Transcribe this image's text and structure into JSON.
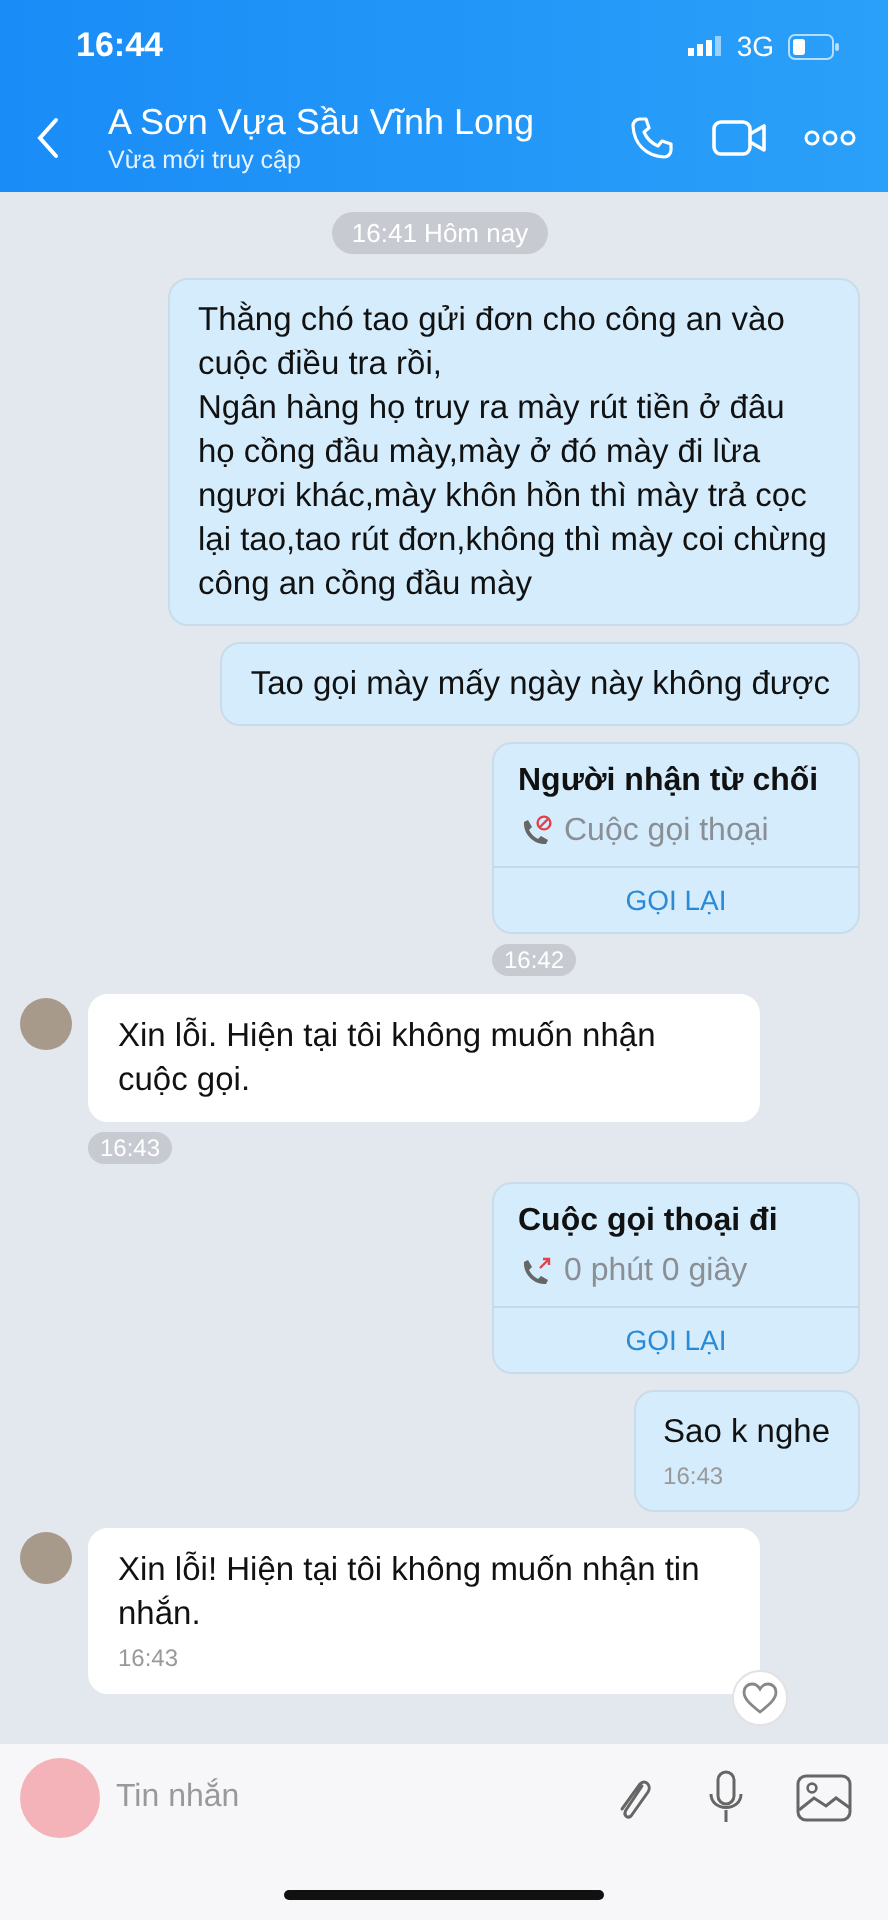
{
  "status_bar": {
    "time": "16:44",
    "network": "3G"
  },
  "header": {
    "title": "A Sơn Vựa Sầu Vĩnh Long",
    "subtitle": "Vừa mới truy cập"
  },
  "date_divider": "16:41 Hôm nay",
  "messages": [
    {
      "kind": "text",
      "outgoing": true,
      "text": "Thằng chó tao gửi đơn cho công an vào cuộc điều tra rồi,\nNgân hàng họ truy ra mày rút tiền ở đâu họ cồng đầu mày,mày ở đó mày đi lừa ngươi khác,mày khôn hồn thì mày trả cọc lại tao,tao rút đơn,không thì mày coi chừng công an cồng đầu mày"
    },
    {
      "kind": "text",
      "outgoing": true,
      "text": "Tao gọi mày mấy ngày này không được"
    },
    {
      "kind": "call",
      "outgoing": true,
      "title": "Người nhận từ chối",
      "detail": "Cuộc gọi thoại",
      "action": "GỌI LẠI",
      "declined": true,
      "time_pill": "16:42"
    },
    {
      "kind": "text",
      "outgoing": false,
      "avatar": true,
      "text": "Xin lỗi. Hiện tại tôi không muốn nhận cuộc gọi.",
      "time_pill": "16:43"
    },
    {
      "kind": "call",
      "outgoing": true,
      "title": "Cuộc gọi thoại đi",
      "detail": "0 phút 0 giây",
      "action": "GỌI LẠI",
      "declined": false
    },
    {
      "kind": "text",
      "outgoing": true,
      "text": "Sao k nghe",
      "time": "16:43"
    },
    {
      "kind": "text",
      "outgoing": false,
      "avatar": true,
      "text": "Xin lỗi! Hiện tại tôi không muốn nhận tin nhắn.",
      "time": "16:43",
      "reaction_button": true
    }
  ],
  "composer": {
    "placeholder": "Tin nhắn"
  }
}
